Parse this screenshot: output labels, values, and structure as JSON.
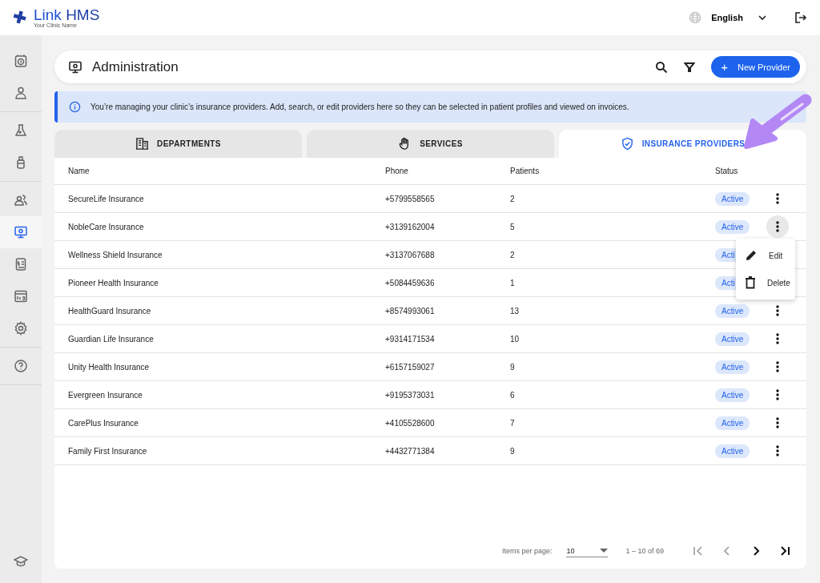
{
  "brand": {
    "name": "Link",
    "name_bold": "HMS",
    "tagline": "Your Clinic Name"
  },
  "header": {
    "language": "English"
  },
  "sidebar": {
    "groups": [
      [
        {
          "selected": false
        },
        {
          "selected": false
        }
      ],
      [
        {
          "selected": false
        },
        {
          "selected": false
        }
      ],
      [
        {
          "selected": false
        },
        {
          "selected": true
        },
        {
          "selected": false
        },
        {
          "selected": false
        },
        {
          "selected": false
        }
      ],
      [
        {
          "selected": false
        }
      ]
    ]
  },
  "page": {
    "title": "Administration",
    "new_button": "New Provider",
    "plus": "+"
  },
  "info": "You’re managing your clinic’s insurance providers. Add, search, or edit providers here so they can be selected in patient profiles and viewed on invoices.",
  "tabs": [
    {
      "label": "DEPARTMENTS",
      "selected": false
    },
    {
      "label": "SERVICES",
      "selected": false
    },
    {
      "label": "INSURANCE PROVIDERS",
      "selected": true
    }
  ],
  "table": {
    "columns": [
      "Name",
      "Phone",
      "Patients",
      "Status"
    ],
    "rows": [
      {
        "name": "SecureLife Insurance",
        "phone": "+5799558565",
        "patients": "2",
        "status": "Active",
        "menu_open": false
      },
      {
        "name": "NobleCare Insurance",
        "phone": "+3139162004",
        "patients": "5",
        "status": "Active",
        "menu_open": true
      },
      {
        "name": "Wellness Shield Insurance",
        "phone": "+3137067688",
        "patients": "2",
        "status": "Acti",
        "actions_button": false
      },
      {
        "name": "Pioneer Health Insurance",
        "phone": "+5084459636",
        "patients": "1",
        "status": "Acti",
        "actions_button": false
      },
      {
        "name": "HealthGuard Insurance",
        "phone": "+8574993061",
        "patients": "13",
        "status": "Active",
        "menu_open": false
      },
      {
        "name": "Guardian Life Insurance",
        "phone": "+9314171534",
        "patients": "10",
        "status": "Active",
        "menu_open": false
      },
      {
        "name": "Unity Health Insurance",
        "phone": "+6157159027",
        "patients": "9",
        "status": "Active",
        "menu_open": false
      },
      {
        "name": "Evergreen Insurance",
        "phone": "+9195373031",
        "patients": "6",
        "status": "Active",
        "menu_open": false
      },
      {
        "name": "CarePlus Insurance",
        "phone": "+4105528600",
        "patients": "7",
        "status": "Active",
        "menu_open": false
      },
      {
        "name": "Family First Insurance",
        "phone": "+4432771384",
        "patients": "9",
        "status": "Active",
        "menu_open": false
      }
    ],
    "row_menu": [
      {
        "label": "Edit",
        "kind": "edit"
      },
      {
        "label": "Delete",
        "kind": "delete"
      }
    ]
  },
  "pagination": {
    "items_label": "Items per page:",
    "page_size": "10",
    "range": "1 – 10 of 69"
  }
}
